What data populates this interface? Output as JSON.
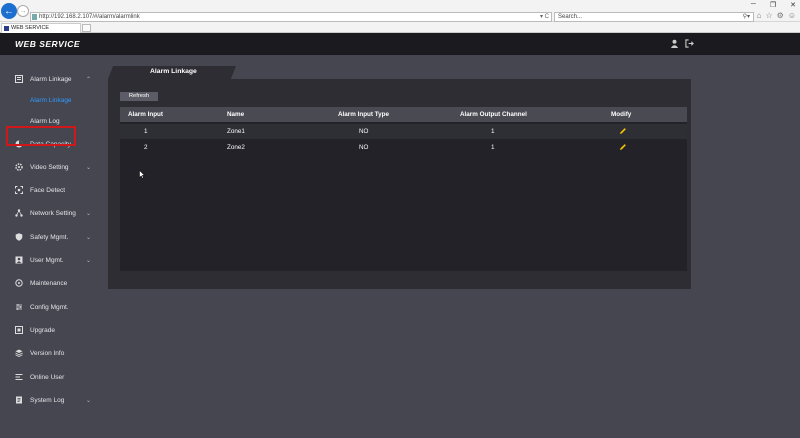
{
  "browser": {
    "url": "http://192.168.2.107/#/alarm/alarmlink",
    "addr_controls": "▾ C",
    "search_placeholder": "Search...",
    "tab_title": "WEB SERVICE",
    "win_min": "─",
    "win_max": "❐",
    "win_close": "✕"
  },
  "header": {
    "title": "WEB SERVICE"
  },
  "sidebar": {
    "items": [
      {
        "label": "Alarm Linkage",
        "icon": "alarm-linkage-icon",
        "chevron": "⌃"
      },
      {
        "label": "Data Capacity",
        "icon": "pie-chart-icon"
      },
      {
        "label": "Video Setting",
        "icon": "video-setting-icon",
        "chevron": "⌄"
      },
      {
        "label": "Face Detect",
        "icon": "face-detect-icon"
      },
      {
        "label": "Network Setting",
        "icon": "network-icon",
        "chevron": "⌄"
      },
      {
        "label": "Safety Mgmt.",
        "icon": "shield-icon",
        "chevron": "⌄"
      },
      {
        "label": "User Mgmt.",
        "icon": "user-icon",
        "chevron": "⌄"
      },
      {
        "label": "Maintenance",
        "icon": "maintenance-icon"
      },
      {
        "label": "Config Mgmt.",
        "icon": "config-icon"
      },
      {
        "label": "Upgrade",
        "icon": "upgrade-icon"
      },
      {
        "label": "Version Info",
        "icon": "version-icon"
      },
      {
        "label": "Online User",
        "icon": "online-user-icon"
      },
      {
        "label": "System Log",
        "icon": "system-log-icon",
        "chevron": "⌄"
      }
    ],
    "subitems": [
      {
        "label": "Alarm Linkage",
        "active": true
      },
      {
        "label": "Alarm Log",
        "active": false
      }
    ],
    "accent_color": "#2e9bff",
    "highlight_color": "#d0181b"
  },
  "main": {
    "tab_label": "Alarm Linkage",
    "refresh_label": "Refresh",
    "columns": [
      "Alarm Input",
      "Name",
      "Alarm Input Type",
      "Alarm Output Channel",
      "Modify"
    ],
    "rows": [
      {
        "input": "1",
        "name": "Zone1",
        "type": "NO",
        "output": "1",
        "modify": "edit-icon"
      },
      {
        "input": "2",
        "name": "Zone2",
        "type": "NO",
        "output": "1",
        "modify": "edit-icon"
      }
    ],
    "edit_icon_color": "#f2c200"
  }
}
